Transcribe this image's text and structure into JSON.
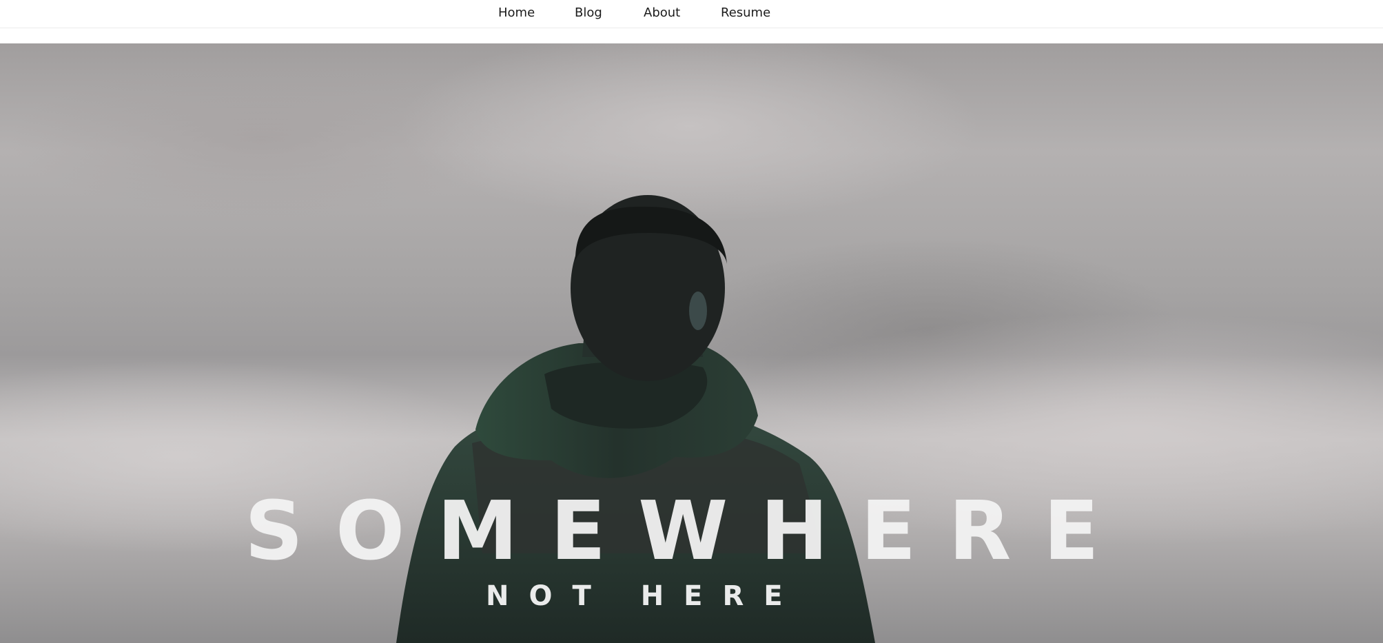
{
  "nav": {
    "items": [
      {
        "label": "Home"
      },
      {
        "label": "Blog"
      },
      {
        "label": "About"
      },
      {
        "label": "Resume"
      }
    ]
  },
  "hero": {
    "title": "SOMEWHERE",
    "subtitle": "NOT HERE"
  },
  "colors": {
    "nav_background": "#ffffff",
    "nav_text": "#1b1b1b",
    "hero_text": "#f2f2f2",
    "jacket": "#2a3a33"
  }
}
